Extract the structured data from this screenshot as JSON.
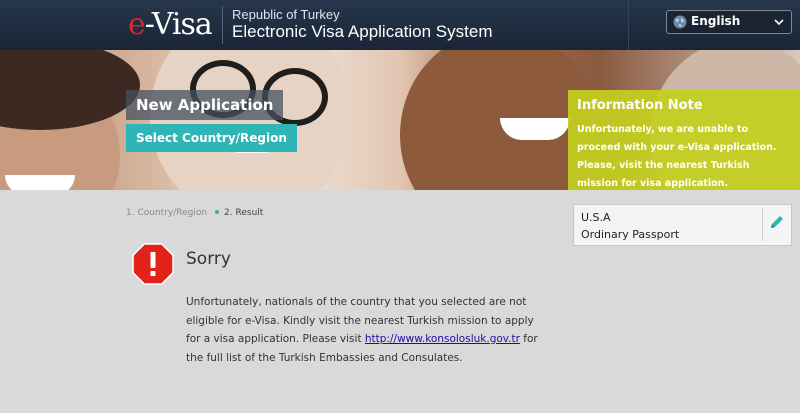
{
  "header": {
    "logo_e": "e",
    "logo_visa": "-Visa",
    "republic": "Republic of Turkey",
    "system": "Electronic Visa Application System",
    "language": "English"
  },
  "banner": {
    "new_application": "New Application",
    "select_country": "Select Country/Region"
  },
  "info_note": {
    "title": "Information Note",
    "body": "Unfortunately, we are unable to proceed with your e-Visa application. Please, visit the nearest Turkish mission for visa application."
  },
  "steps": {
    "step1": "1. Country/Region",
    "step2": "2. Result"
  },
  "passport": {
    "country": "U.S.A",
    "type": "Ordinary Passport"
  },
  "result": {
    "title": "Sorry",
    "message_before_link": "Unfortunately, nationals of the country that you selected are not eligible for e-Visa. Kindly visit the nearest Turkish mission to apply for a visa application. Please visit ",
    "link": "http://www.konsolosluk.gov.tr",
    "message_after_link": " for the full list of the Turkish Embassies and Consulates."
  },
  "icons": [
    "globe-icon",
    "chevron-down-icon",
    "pencil-icon",
    "stop-warning-icon"
  ],
  "colors": {
    "header_bg": "#1f2c3f",
    "accent_teal": "#2fb5b5",
    "info_yellow": "#c4cf1e",
    "logo_red": "#d8262c",
    "stop_red": "#e2231a"
  }
}
